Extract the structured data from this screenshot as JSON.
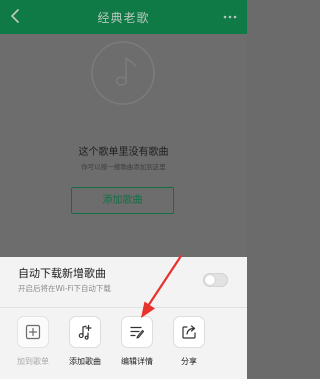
{
  "header": {
    "title": "经典老歌",
    "back_icon": "chevron-left-icon",
    "more_icon": "more-dots-icon"
  },
  "empty_state": {
    "icon": "music-disc-icon",
    "title": "这个歌单里没有歌曲",
    "subtitle": "你可以搜一搜歌曲添加到这里",
    "add_button": "添加歌曲"
  },
  "sheet": {
    "auto_download_title": "自动下载新增歌曲",
    "auto_download_subtitle": "开启后将在Wi-Fi下自动下载",
    "auto_download_enabled": false,
    "actions": [
      {
        "label": "加到歌单",
        "icon": "add-square-icon",
        "enabled": false
      },
      {
        "label": "添加歌曲",
        "icon": "add-music-icon",
        "enabled": true
      },
      {
        "label": "编辑详情",
        "icon": "edit-details-icon",
        "enabled": true
      },
      {
        "label": "分享",
        "icon": "share-icon",
        "enabled": true
      }
    ]
  },
  "annotation": {
    "color": "#e8332c",
    "points_to": "编辑详情"
  }
}
